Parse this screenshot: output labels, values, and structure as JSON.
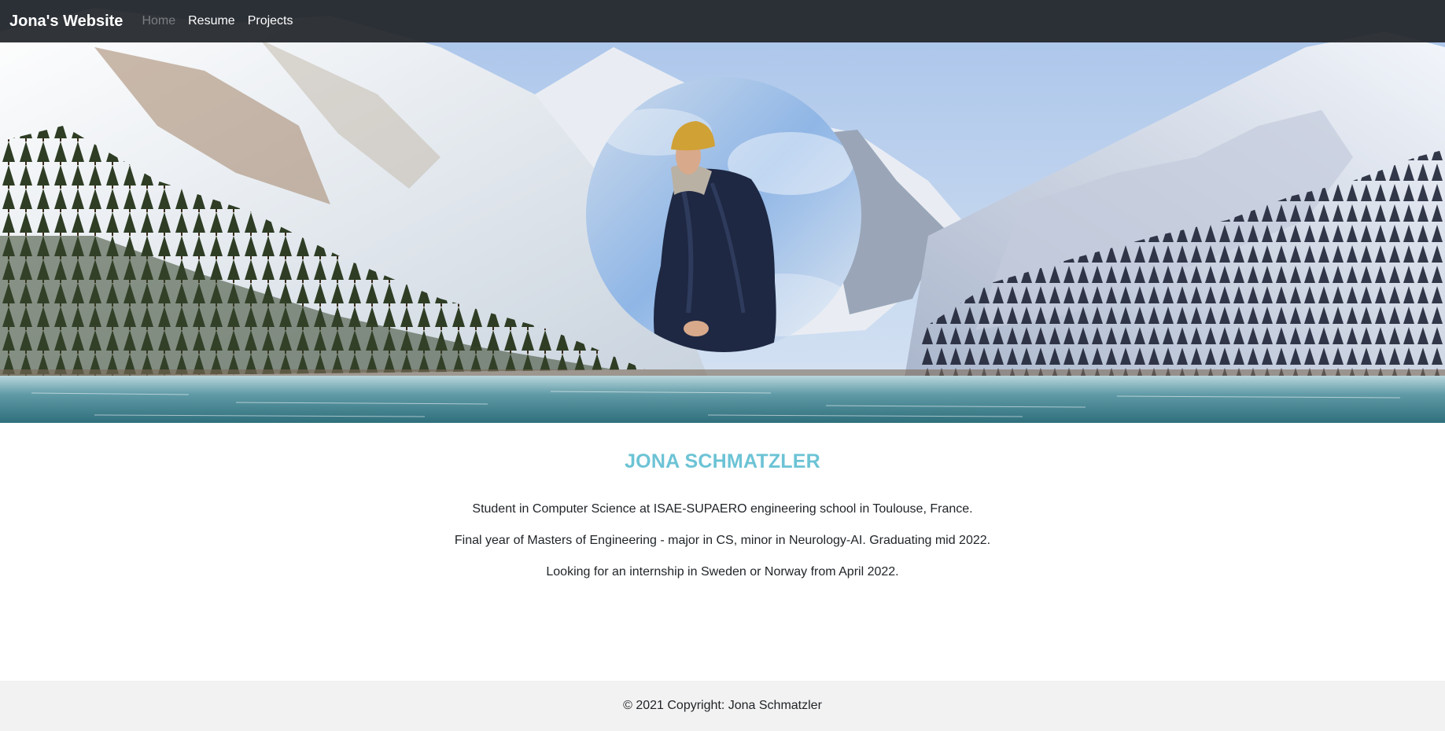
{
  "navbar": {
    "brand": "Jona's Website",
    "items": [
      {
        "label": "Home",
        "active": true
      },
      {
        "label": "Resume",
        "active": false
      },
      {
        "label": "Projects",
        "active": false
      }
    ]
  },
  "hero": {
    "background": "snowy-mountain-lake-image",
    "portrait": "profile-photo-circle"
  },
  "profile": {
    "name": "JONA SCHMATZLER",
    "bio": [
      "Student in Computer Science at ISAE-SUPAERO engineering school in Toulouse, France.",
      "Final year of Masters of Engineering - major in CS, minor in Neurology-AI. Graduating mid 2022.",
      "Looking for an internship in Sweden or Norway from April 2022."
    ]
  },
  "footer": {
    "copyright": "© 2021 Copyright: Jona Schmatzler"
  },
  "colors": {
    "accent": "#6cc3d5",
    "navbar_bg": "#212529",
    "nav_active": "#7a7f85",
    "footer_bg": "#f2f2f2"
  }
}
